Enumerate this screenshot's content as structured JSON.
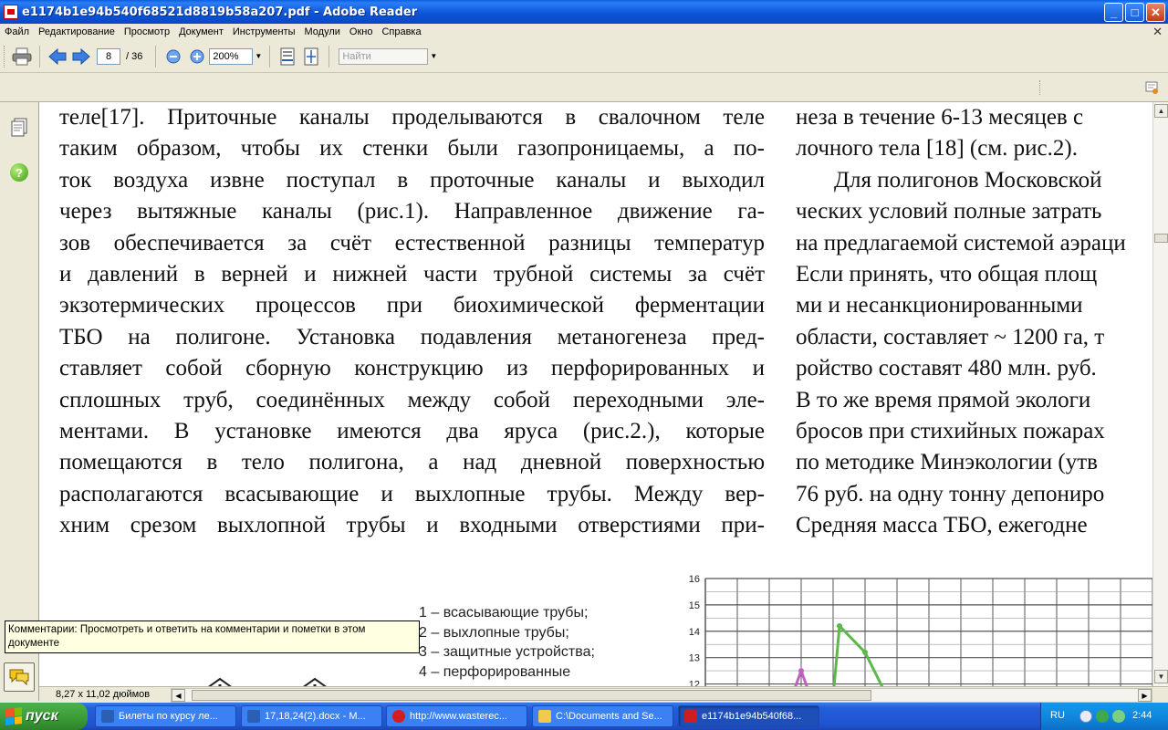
{
  "window": {
    "title": "e1174b1e94b540f68521d8819b58a207.pdf - Adobe Reader",
    "controls": {
      "minimize": "_",
      "maximize": "□",
      "close": "✕"
    }
  },
  "menu": {
    "items": [
      "Файл",
      "Редактирование",
      "Просмотр",
      "Документ",
      "Инструменты",
      "Модули",
      "Окно",
      "Справка"
    ],
    "close_glyph": "✕"
  },
  "toolbar": {
    "page_current": "8",
    "page_total": "/ 36",
    "zoom": "200%",
    "find_placeholder": "Найти"
  },
  "document": {
    "left_lines": [
      "теле[17]. Приточные каналы проделываются в свалочном теле",
      "таким образом, чтобы их стенки были газопроницаемы, а по-",
      "ток воздуха извне поступал в проточные каналы и выходил",
      "через вытяжные каналы (рис.1). Направленное движение га-",
      "зов обеспечивается за счёт естественной разницы температур",
      "и давлений в верней и нижней части трубной системы за счёт",
      "экзотермических процессов при биохимической ферментации",
      "ТБО на полигоне. Установка подавления метаногенеза пред-",
      "ставляет собой сборную конструкцию из перфорированных и",
      "сплошных труб, соединённых между собой переходными эле-",
      "ментами. В установке имеются два яруса (рис.2.), которые",
      "помещаются в тело полигона, а над дневной поверхностью",
      "располагаются всасывающие и выхлопные трубы. Между вер-",
      "хним срезом выхлопной трубы и входными отверстиями при-"
    ],
    "right_lines": [
      "неза в течение 6-13 месяцев с",
      "лочного тела [18] (см. рис.2).",
      "Для полигонов Московской",
      "ческих условий полные затрать",
      "на предлагаемой системой аэраци",
      "Если принять, что общая площ",
      "ми и несанкционированными",
      "области, составляет ~ 1200 га, т",
      "ройство составят 480 млн. руб.",
      "В то же время прямой экологи",
      "бросов при стихийных пожарах",
      "по методике Минэкологии (утв",
      "76 руб. на одну тонну депониро",
      "Средняя масса ТБО, ежегодне"
    ],
    "legend": [
      "1 – всасывающие трубы;",
      "2 – выхлопные трубы;",
      "3 – защитные устройства;",
      "4 – перфорированные"
    ]
  },
  "chart_data": {
    "type": "line",
    "title": "",
    "xlabel": "",
    "ylabel": "",
    "ylim": [
      11.5,
      16
    ],
    "y_ticks": [
      "16",
      "15",
      "14",
      "13",
      "12"
    ],
    "grid": true,
    "series": [
      {
        "color": "#5cb84a",
        "x": [
          4.0,
          4.2,
          5.0,
          5.7
        ],
        "y": [
          11.5,
          14.2,
          13.2,
          11.5
        ]
      },
      {
        "color": "#c060c0",
        "x": [
          2.7,
          3.0,
          3.3
        ],
        "y": [
          11.5,
          12.5,
          11.5
        ]
      }
    ]
  },
  "statusbar": {
    "page_size": "8,27 x 11,02 дюймов"
  },
  "tooltip": {
    "text": "Комментарии: Просмотреть и ответить на комментарии и пометки в этом документе"
  },
  "taskbar": {
    "start_label": "пуск",
    "tasks": [
      {
        "label": "Билеты по курсу ле...",
        "color": "#2b5fb3"
      },
      {
        "label": "17,18,24(2).docx - M...",
        "color": "#2b5fb3"
      },
      {
        "label": "http://www.wasterec...",
        "color": "#d41d1d"
      },
      {
        "label": "C:\\Documents and Se...",
        "color": "#f2c94c"
      },
      {
        "label": "e1174b1e94b540f68...",
        "color": "#cc1f1f"
      }
    ],
    "lang": "RU",
    "clock": "2:44"
  }
}
